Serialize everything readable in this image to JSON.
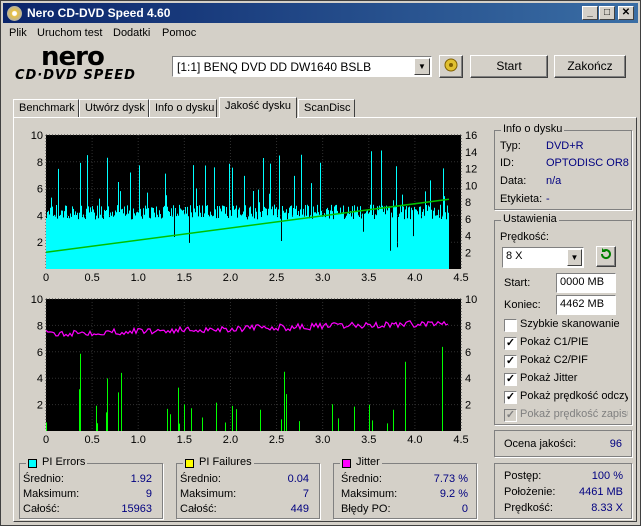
{
  "window": {
    "title": "Nero CD-DVD Speed 4.60"
  },
  "menu": [
    "Plik",
    "Uruchom test",
    "Dodatki",
    "Pomoc"
  ],
  "logo": {
    "line1": "nero",
    "line2": "CD·DVD SPEED"
  },
  "drive": {
    "selected": "[1:1]  BENQ DVD DD DW1640 BSLB"
  },
  "buttons": {
    "start": "Start",
    "stop": "Zakończ"
  },
  "tabs": [
    "Benchmark",
    "Utwórz dysk",
    "Info o dysku",
    "Jakość dysku",
    "ScanDisc"
  ],
  "active_tab": "Jakość dysku",
  "disc_info": {
    "title": "Info o dysku",
    "type_label": "Typ:",
    "type_value": "DVD+R",
    "id_label": "ID:",
    "id_value": "OPTODISC OR8",
    "date_label": "Data:",
    "date_value": "n/a",
    "tags_label": "Etykieta:",
    "tags_value": "-"
  },
  "settings": {
    "title": "Ustawienia",
    "speed_label": "Prędkość:",
    "speed_value": "8 X",
    "start_label": "Start:",
    "start_value": "0000 MB",
    "end_label": "Koniec:",
    "end_value": "4462 MB",
    "options": [
      {
        "label": "Szybkie skanowanie",
        "checked": false,
        "disabled": false
      },
      {
        "label": "Pokaż C1/PIE",
        "checked": true,
        "disabled": false
      },
      {
        "label": "Pokaż C2/PIF",
        "checked": true,
        "disabled": false
      },
      {
        "label": "Pokaż Jitter",
        "checked": true,
        "disabled": false
      },
      {
        "label": "Pokaż prędkość odczytu",
        "checked": true,
        "disabled": false
      },
      {
        "label": "Pokaż prędkość zapisu",
        "checked": true,
        "disabled": true
      }
    ]
  },
  "quality": {
    "label": "Ocena jakości:",
    "value": "96"
  },
  "pi_errors": {
    "title": "PI Errors",
    "color": "#00ffff",
    "avg_label": "Średnio:",
    "avg": "1.92",
    "max_label": "Maksimum:",
    "max": "9",
    "total_label": "Całość:",
    "total": "15963"
  },
  "pi_failures": {
    "title": "PI Failures",
    "color": "#ffff00",
    "avg_label": "Średnio:",
    "avg": "0.04",
    "max_label": "Maksimum:",
    "max": "7",
    "total_label": "Całość:",
    "total": "449"
  },
  "jitter": {
    "title": "Jitter",
    "color": "#ff00ff",
    "avg_label": "Średnio:",
    "avg": "7.73 %",
    "max_label": "Maksimum:",
    "max": "9.2 %",
    "po_label": "Błędy PO:",
    "po": "0"
  },
  "progress": {
    "progress_label": "Postęp:",
    "progress": "100 %",
    "position_label": "Położenie:",
    "position": "4461 MB",
    "speed_label": "Prędkość:",
    "speed": "8.33 X"
  },
  "chart_data": [
    {
      "type": "bar",
      "series": [
        {
          "name": "PI Errors",
          "color": "#00ffff"
        },
        {
          "name": "Read speed",
          "color": "#00c000"
        }
      ],
      "x_ticks": [
        "0",
        "0.5",
        "1.0",
        "1.5",
        "2.0",
        "2.5",
        "3.0",
        "3.5",
        "4.0",
        "4.5"
      ],
      "y_left_ticks": [
        "10",
        "8",
        "6",
        "4",
        "2"
      ],
      "y_right_ticks": [
        "16",
        "14",
        "12",
        "10",
        "8",
        "6",
        "4",
        "2"
      ],
      "xlim": [
        0,
        4.5
      ],
      "ylim_left": [
        0,
        10
      ],
      "ylim_right": [
        0,
        16
      ],
      "pie_baseline": 4,
      "pie_max": 9,
      "speed_line": [
        [
          0,
          2.0
        ],
        [
          4.37,
          8.33
        ]
      ]
    },
    {
      "type": "bar",
      "series": [
        {
          "name": "PI Failures",
          "color": "#00ff00"
        },
        {
          "name": "Jitter",
          "color": "#ff00ff"
        }
      ],
      "x_ticks": [
        "0",
        "0.5",
        "1.0",
        "1.5",
        "2.0",
        "2.5",
        "3.0",
        "3.5",
        "4.0",
        "4.5"
      ],
      "y_left_ticks": [
        "10",
        "8",
        "6",
        "4",
        "2"
      ],
      "y_right_ticks": [
        "10",
        "8",
        "6",
        "4",
        "2"
      ],
      "xlim": [
        0,
        4.5
      ],
      "ylim_left": [
        0,
        10
      ],
      "ylim_right": [
        0,
        10
      ],
      "pif_max": 7,
      "jitter_avg": 7.73
    }
  ]
}
